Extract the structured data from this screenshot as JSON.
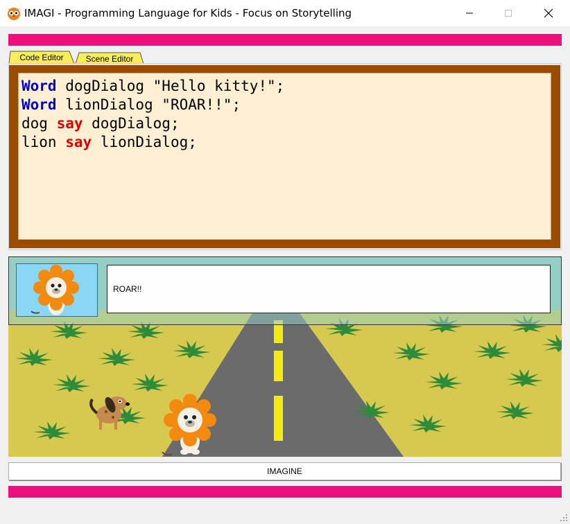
{
  "window": {
    "title": "IMAGI - Programming Language for Kids - Focus on Storytelling",
    "icon": "owl-app-icon",
    "controls": [
      "minimize-icon",
      "maximize-icon",
      "close-icon"
    ]
  },
  "colors": {
    "accent_bar": "#ec0f7c",
    "tab": "#f7ee5a",
    "editor_frame": "#9a4c00",
    "editor_bg": "#ffefd2",
    "keyword_type": "#0000cc",
    "keyword_action": "#dd0000"
  },
  "tabs": [
    {
      "label": "Code Editor",
      "selected": true
    },
    {
      "label": "Scene Editor",
      "selected": false
    }
  ],
  "code": {
    "lines": [
      {
        "kw": "Word",
        "rest": " dogDialog \"Hello kitty!\";"
      },
      {
        "kw": "Word",
        "rest": " lionDialog \"ROAR!!\";"
      },
      {
        "subject": "dog ",
        "action": "say",
        "rest": " dogDialog;"
      },
      {
        "subject": "lion ",
        "action": "say",
        "rest": " lionDialog;"
      }
    ]
  },
  "scene": {
    "dialog": {
      "speaker_icon": "lion-icon",
      "text": "ROAR!!"
    },
    "characters": [
      "dog-icon",
      "lion-icon"
    ]
  },
  "imagine_button": {
    "label": "IMAGINE"
  }
}
